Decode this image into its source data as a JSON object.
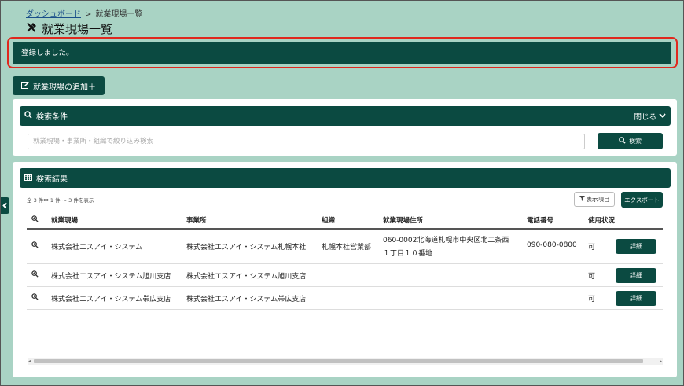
{
  "breadcrumb": {
    "home": "ダッシュボード",
    "separator": ">",
    "current": "就業現場一覧"
  },
  "page_title": "就業現場一覧",
  "alert": {
    "message": "登録しました。"
  },
  "add_button": {
    "label": "就業現場の追加＋"
  },
  "search_panel": {
    "title": "検索条件",
    "close_label": "閉じる",
    "input_placeholder": "就業現場・事業所・組織で絞り込み検索",
    "search_button": "検索"
  },
  "results_panel": {
    "title": "検索結果",
    "count_text": "全 3 件中 1 件 ～ 3 件を表示",
    "display_items_button": "表示項目",
    "export_button": "エクスポート",
    "columns": [
      "就業現場",
      "事業所",
      "組織",
      "就業現場住所",
      "電話番号",
      "使用状況"
    ],
    "rows": [
      {
        "site": "株式会社エスアイ・システム",
        "office": "株式会社エスアイ・システム札幌本社",
        "org": "札幌本社営業部",
        "address_line1": "060-0002北海道札幌市中央区北二条西",
        "address_line2": "１丁目１０番地",
        "phone": "090-080-0800",
        "status": "可",
        "detail": "詳細"
      },
      {
        "site": "株式会社エスアイ・システム旭川支店",
        "office": "株式会社エスアイ・システム旭川支店",
        "org": "",
        "address_line1": "",
        "address_line2": "",
        "phone": "",
        "status": "可",
        "detail": "詳細"
      },
      {
        "site": "株式会社エスアイ・システム帯広支店",
        "office": "株式会社エスアイ・システム帯広支店",
        "org": "",
        "address_line1": "",
        "address_line2": "",
        "phone": "",
        "status": "可",
        "detail": "詳細"
      }
    ]
  },
  "colors": {
    "primary": "#0b4a41",
    "background": "#a9d3c4",
    "alert_outline": "#e0281e"
  }
}
